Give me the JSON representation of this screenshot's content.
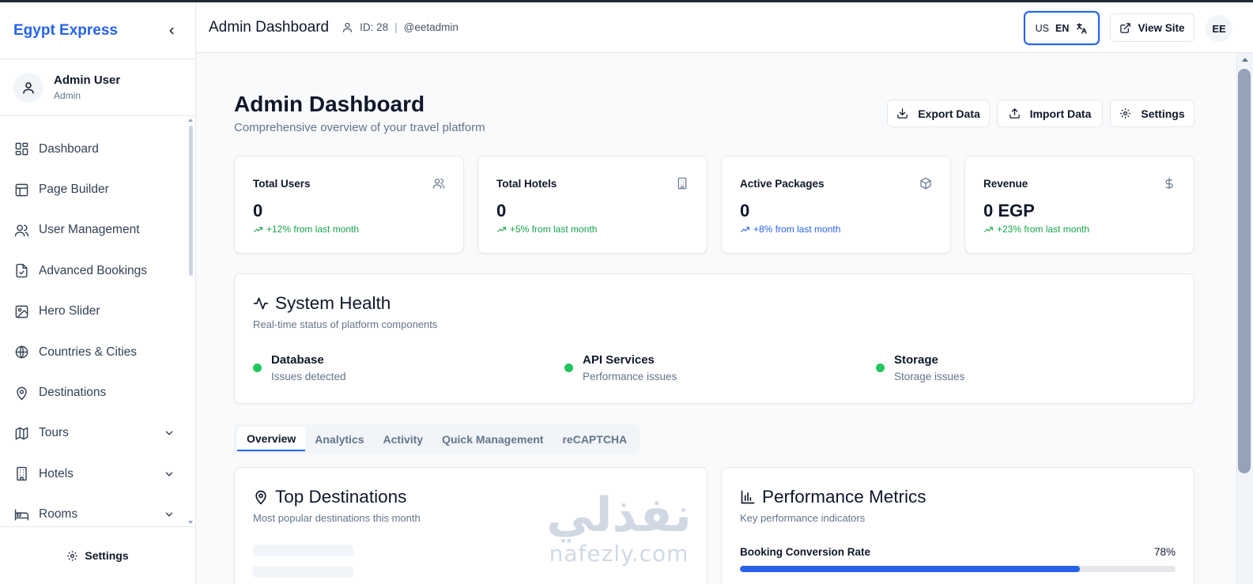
{
  "sidebar": {
    "brand": "Egypt Express",
    "user": {
      "name": "Admin User",
      "role": "Admin"
    },
    "items": [
      {
        "label": "Dashboard",
        "icon": "dashboard-icon"
      },
      {
        "label": "Page Builder",
        "icon": "layout-icon"
      },
      {
        "label": "User Management",
        "icon": "users-icon"
      },
      {
        "label": "Advanced Bookings",
        "icon": "file-check-icon"
      },
      {
        "label": "Hero Slider",
        "icon": "image-icon"
      },
      {
        "label": "Countries & Cities",
        "icon": "globe-icon"
      },
      {
        "label": "Destinations",
        "icon": "map-pin-icon"
      },
      {
        "label": "Tours",
        "icon": "map-icon",
        "expandable": true
      },
      {
        "label": "Hotels",
        "icon": "building-icon",
        "expandable": true
      },
      {
        "label": "Rooms",
        "icon": "bed-icon",
        "expandable": true
      }
    ],
    "footer_label": "Settings"
  },
  "header": {
    "title": "Admin Dashboard",
    "id_text": "ID: 28",
    "separator": "|",
    "username": "@eetadmin",
    "lang_flag": "US",
    "lang_code": "EN",
    "view_site": "View Site",
    "avatar_initials": "EE"
  },
  "page": {
    "title": "Admin Dashboard",
    "subtitle": "Comprehensive overview of your travel platform",
    "actions": {
      "export": "Export Data",
      "import": "Import Data",
      "settings": "Settings"
    }
  },
  "stats": [
    {
      "label": "Total Users",
      "value": "0",
      "delta": "+12% from last month",
      "color": "#16a34a",
      "icon": "users-icon"
    },
    {
      "label": "Total Hotels",
      "value": "0",
      "delta": "+5% from last month",
      "color": "#16a34a",
      "icon": "building-icon"
    },
    {
      "label": "Active Packages",
      "value": "0",
      "delta": "+8% from last month",
      "color": "#2563eb",
      "icon": "package-icon"
    },
    {
      "label": "Revenue",
      "value": "0 EGP",
      "delta": "+23% from last month",
      "color": "#16a34a",
      "icon": "dollar-icon"
    }
  ],
  "system_health": {
    "title": "System Health",
    "subtitle": "Real-time status of platform components",
    "items": [
      {
        "name": "Database",
        "status": "Issues detected"
      },
      {
        "name": "API Services",
        "status": "Performance issues"
      },
      {
        "name": "Storage",
        "status": "Storage issues"
      }
    ],
    "status_color": "#22c55e"
  },
  "tabs": [
    "Overview",
    "Analytics",
    "Activity",
    "Quick Management",
    "reCAPTCHA"
  ],
  "active_tab": "Overview",
  "top_destinations": {
    "title": "Top Destinations",
    "subtitle": "Most popular destinations this month"
  },
  "performance": {
    "title": "Performance Metrics",
    "subtitle": "Key performance indicators",
    "metric_label": "Booking Conversion Rate",
    "metric_value": "78%",
    "metric_fraction": 0.78
  },
  "watermark": {
    "arabic": "نفذلي",
    "latin": "nafezly.com"
  },
  "colors": {
    "accent": "#2563eb",
    "success": "#16a34a"
  }
}
